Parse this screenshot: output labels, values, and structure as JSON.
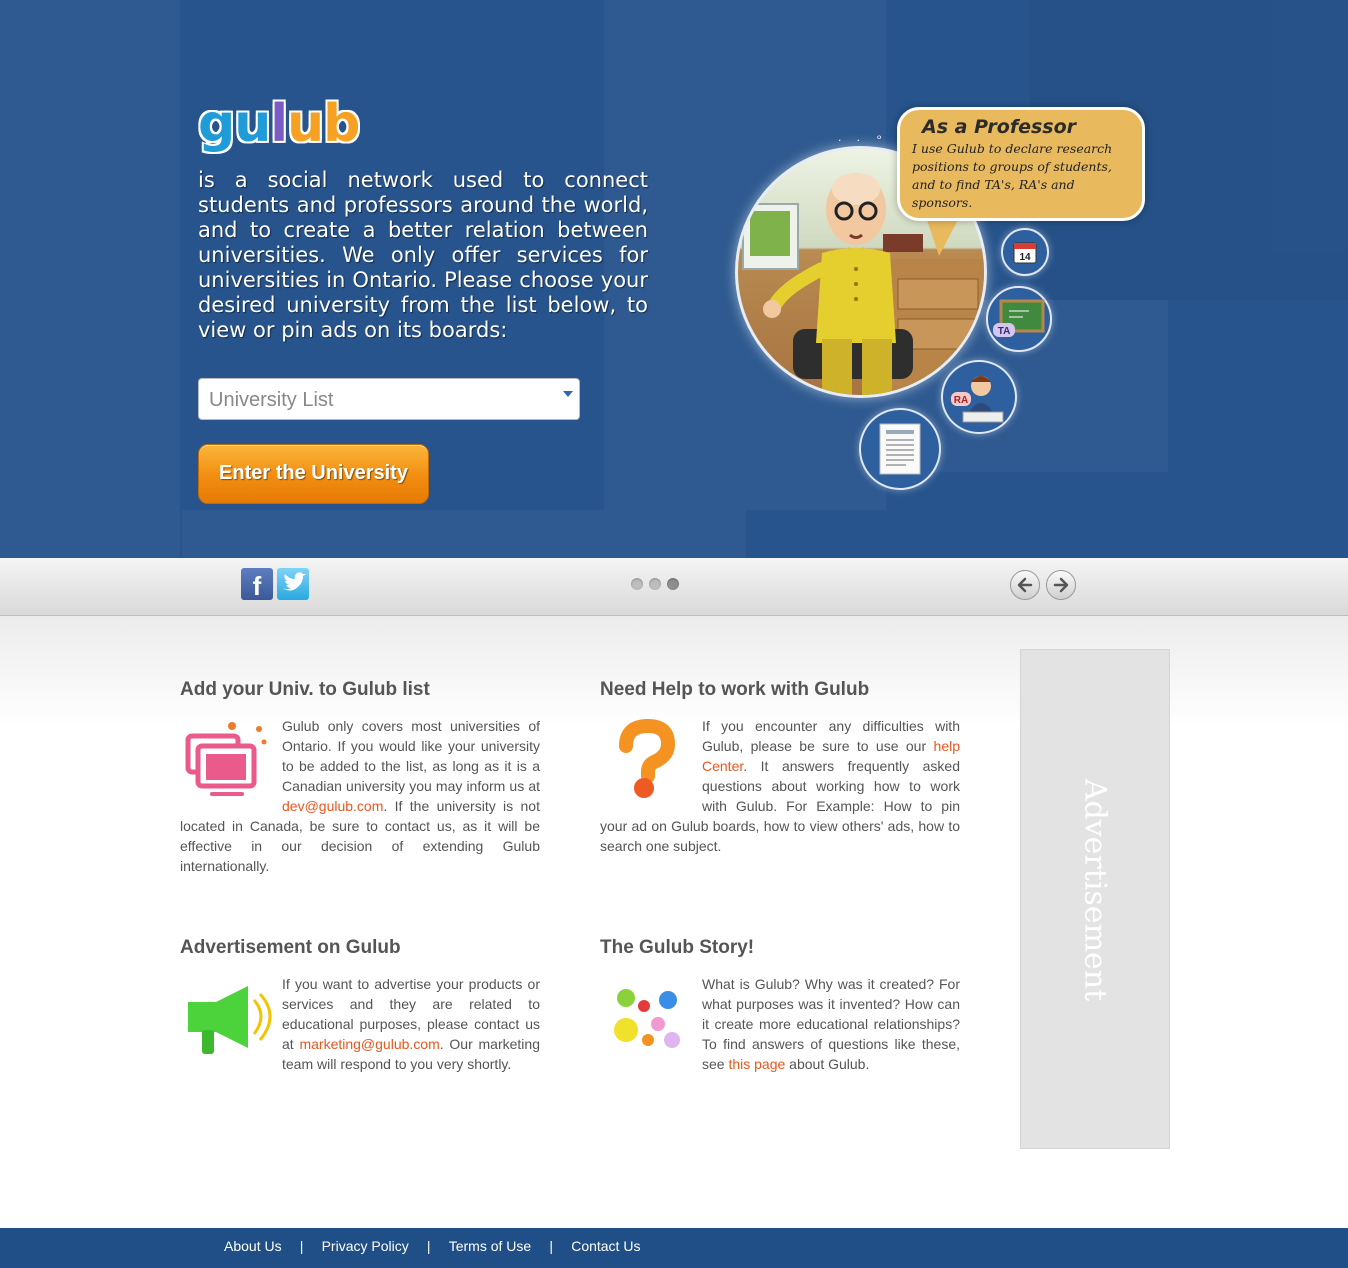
{
  "hero": {
    "logo_letters": [
      "g",
      "u",
      "l",
      "u",
      "b"
    ],
    "logo_colors": [
      "#1f9bd7",
      "#1f9bd7",
      "#7c5cc4",
      "#f6a124",
      "#f6a124"
    ],
    "intro": "is a social network used to connect students and professors around the world, and to create a better relation between universities. We only offer services for universities in Ontario. Please choose your desired university from the list below, to view or pin ads on its boards:",
    "select_value": "University List",
    "enter_button": "Enter the University",
    "bubble_title": "As a Professor",
    "bubble_text": "I use Gulub to declare research positions to groups of students, and to find TA's, RA's and sponsors.",
    "calendar_day": "14",
    "ta_label": "TA",
    "ra_label": "RA",
    "icons": [
      "calendar-icon",
      "chalkboard-icon",
      "research-assistant-icon",
      "document-icon"
    ]
  },
  "toolbar": {
    "social": [
      "facebook-icon",
      "twitter-icon"
    ],
    "pager_count": 3,
    "active_page": 3,
    "nav": [
      "arrow-left-icon",
      "arrow-right-icon"
    ]
  },
  "sections": {
    "add_univ": {
      "title": "Add your Univ. to Gulub list",
      "text_before": "Gulub only covers most universities of Ontario. If you would like your university to be added to the list, as long as it is a Canadian university you may inform us at ",
      "link": "dev@gulub.com",
      "text_after": ". If the university is not located in Canada, be sure to contact us, as it will be effective in our decision of extending Gulub internationally."
    },
    "help": {
      "title": "Need Help to work with Gulub",
      "text_before": "If you encounter any difficulties with Gulub, please be sure to use our ",
      "link": "help Center",
      "text_after": ". It answers frequently asked questions about working how to work with Gulub. For Example: How to pin your ad on Gulub boards, how to view others' ads, how to search one subject."
    },
    "advert": {
      "title": "Advertisement on Gulub",
      "text_before": "If you want to advertise your products or services and they are related to educational purposes, please contact us at ",
      "link": "marketing@gulub.com",
      "text_after": ". Our marketing team will respond to you very shortly."
    },
    "story": {
      "title": "The Gulub Story!",
      "text_before": "What is Gulub? Why was it created? For what purposes was it invented? How can it create more educational relationships? To find answers of questions like these, see ",
      "link": "this page",
      "text_after": " about Gulub."
    }
  },
  "ad_box": {
    "label": "Advertisement"
  },
  "footer": {
    "links": [
      "About Us",
      "Privacy Policy",
      "Terms of Use",
      "Contact Us"
    ],
    "separator": "|"
  },
  "colors": {
    "hero_bg": "#27548d",
    "accent_orange": "#f28d11",
    "link": "#e9581f",
    "footer_bg": "#1f4f86"
  }
}
